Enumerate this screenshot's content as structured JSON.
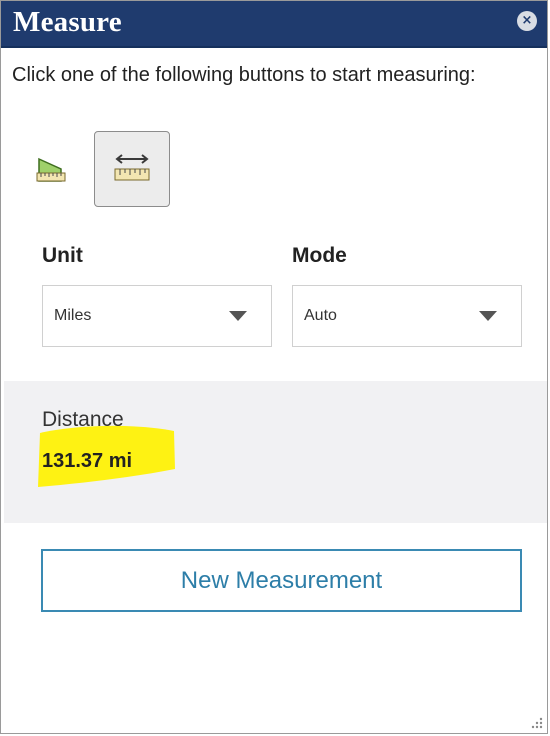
{
  "window": {
    "title": "Measure",
    "close_icon": "×"
  },
  "instructions": "Click one of the following buttons to start measuring:",
  "tools": [
    {
      "name": "area",
      "icon": "area-ruler-icon",
      "selected": false
    },
    {
      "name": "distance",
      "icon": "distance-ruler-icon",
      "selected": true
    }
  ],
  "unit": {
    "label": "Unit",
    "value": "Miles"
  },
  "mode": {
    "label": "Mode",
    "value": "Auto"
  },
  "result": {
    "label": "Distance",
    "value": "131.37 mi",
    "highlight_color": "#fff200"
  },
  "new_measurement_label": "New Measurement",
  "colors": {
    "title_bar": "#1f3b6e",
    "accent": "#2d7ea8"
  }
}
